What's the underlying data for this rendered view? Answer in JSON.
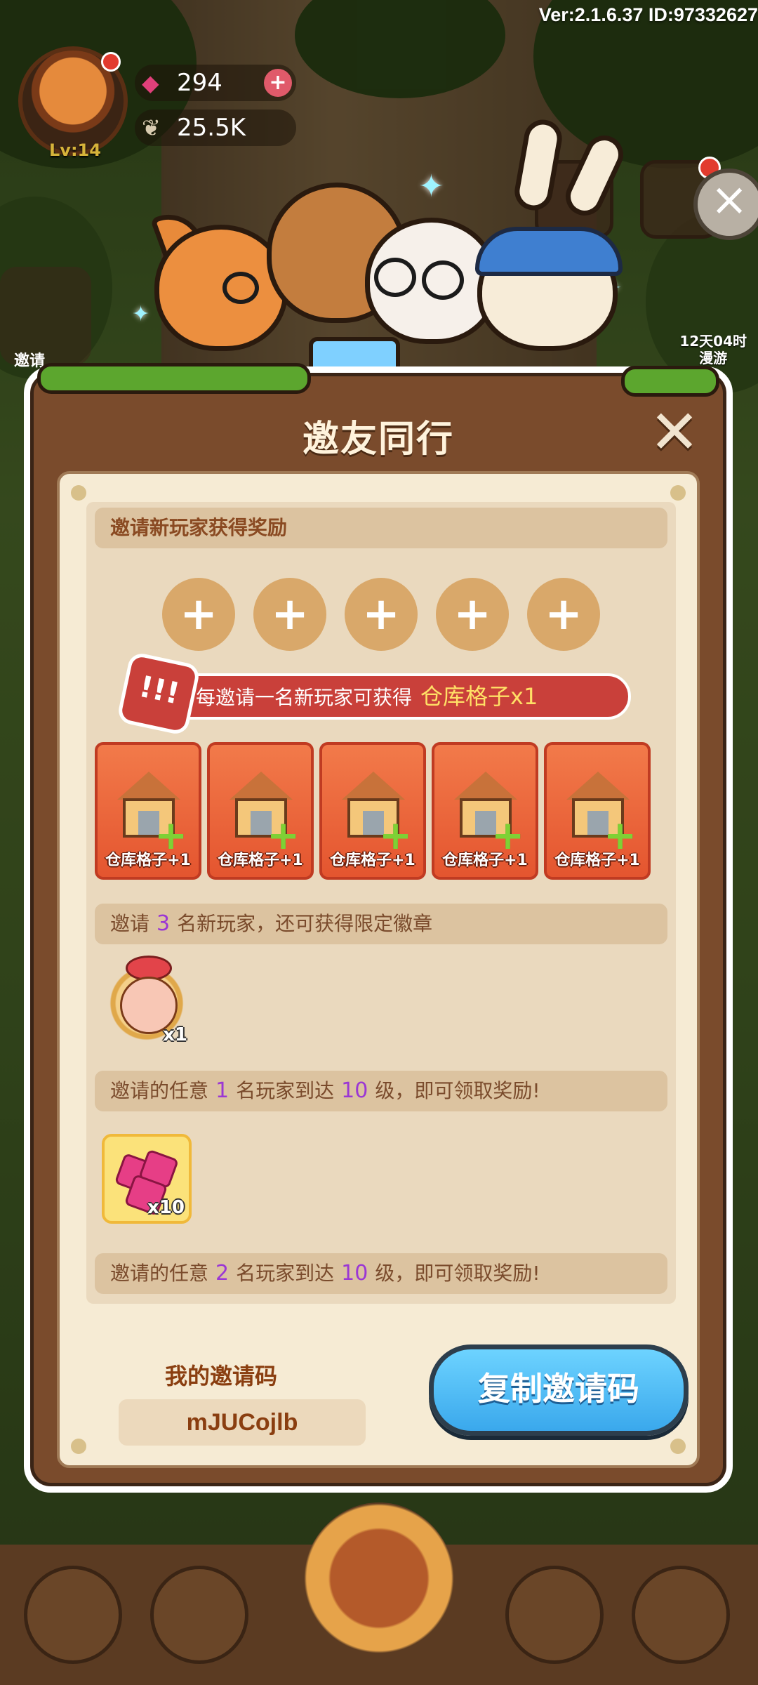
{
  "version_text": "Ver:2.1.6.37 ID:97332627",
  "player": {
    "level": "Lv:14",
    "gems": "294",
    "seeds": "25.5K"
  },
  "side": {
    "left_label": "邀请",
    "right_label_line1": "12天04时",
    "right_label_line2": "漫游"
  },
  "dialog": {
    "title": "邀友同行",
    "section1_header": "邀请新玩家获得奖励",
    "invite_slots": [
      "+",
      "+",
      "+",
      "+",
      "+"
    ],
    "per_invite_text": "每邀请一名新玩家可获得",
    "per_invite_reward": "仓库格子x1",
    "reward_cards": [
      {
        "label": "仓库格子+1"
      },
      {
        "label": "仓库格子+1"
      },
      {
        "label": "仓库格子+1"
      },
      {
        "label": "仓库格子+1"
      },
      {
        "label": "仓库格子+1"
      }
    ],
    "milestone1": {
      "pre": "邀请",
      "num": "3",
      "post": "名新玩家，还可获得限定徽章",
      "item_count": "x1"
    },
    "milestone2": {
      "pre": "邀请的任意",
      "num": "1",
      "mid": "名玩家到达",
      "lv": "10",
      "post": "级，即可领取奖励!",
      "item_count": "x10"
    },
    "milestone3": {
      "pre": "邀请的任意",
      "num": "2",
      "mid": "名玩家到达",
      "lv": "10",
      "post": "级，即可领取奖励!"
    },
    "code_label": "我的邀请码",
    "code_value": "mJUCojlb",
    "copy_button": "复制邀请码"
  },
  "colors": {
    "panel_brown": "#7a4b2c",
    "copy_blue": "#3aa8ec",
    "highlight_purple": "#9b37d4",
    "banner_red": "#c9403a"
  }
}
